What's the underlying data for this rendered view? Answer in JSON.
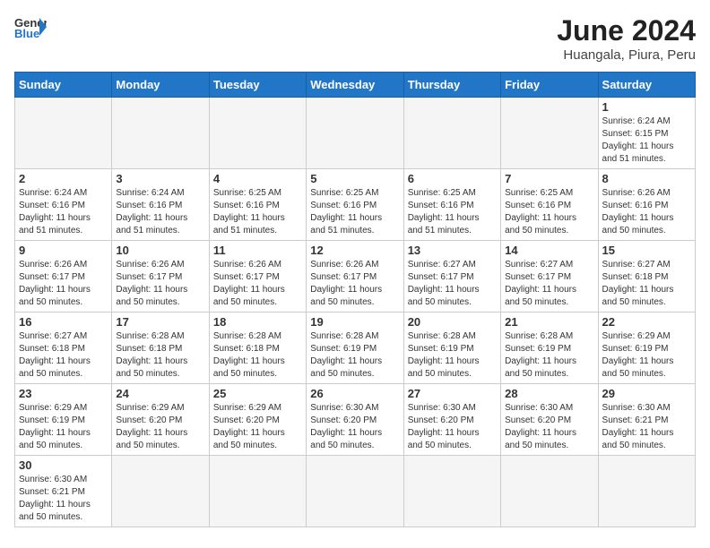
{
  "logo": {
    "text_general": "General",
    "text_blue": "Blue"
  },
  "title": "June 2024",
  "subtitle": "Huangala, Piura, Peru",
  "weekdays": [
    "Sunday",
    "Monday",
    "Tuesday",
    "Wednesday",
    "Thursday",
    "Friday",
    "Saturday"
  ],
  "weeks": [
    [
      {
        "day": "",
        "info": ""
      },
      {
        "day": "",
        "info": ""
      },
      {
        "day": "",
        "info": ""
      },
      {
        "day": "",
        "info": ""
      },
      {
        "day": "",
        "info": ""
      },
      {
        "day": "",
        "info": ""
      },
      {
        "day": "1",
        "info": "Sunrise: 6:24 AM\nSunset: 6:15 PM\nDaylight: 11 hours\nand 51 minutes."
      }
    ],
    [
      {
        "day": "2",
        "info": "Sunrise: 6:24 AM\nSunset: 6:16 PM\nDaylight: 11 hours\nand 51 minutes."
      },
      {
        "day": "3",
        "info": "Sunrise: 6:24 AM\nSunset: 6:16 PM\nDaylight: 11 hours\nand 51 minutes."
      },
      {
        "day": "4",
        "info": "Sunrise: 6:25 AM\nSunset: 6:16 PM\nDaylight: 11 hours\nand 51 minutes."
      },
      {
        "day": "5",
        "info": "Sunrise: 6:25 AM\nSunset: 6:16 PM\nDaylight: 11 hours\nand 51 minutes."
      },
      {
        "day": "6",
        "info": "Sunrise: 6:25 AM\nSunset: 6:16 PM\nDaylight: 11 hours\nand 51 minutes."
      },
      {
        "day": "7",
        "info": "Sunrise: 6:25 AM\nSunset: 6:16 PM\nDaylight: 11 hours\nand 50 minutes."
      },
      {
        "day": "8",
        "info": "Sunrise: 6:26 AM\nSunset: 6:16 PM\nDaylight: 11 hours\nand 50 minutes."
      }
    ],
    [
      {
        "day": "9",
        "info": "Sunrise: 6:26 AM\nSunset: 6:17 PM\nDaylight: 11 hours\nand 50 minutes."
      },
      {
        "day": "10",
        "info": "Sunrise: 6:26 AM\nSunset: 6:17 PM\nDaylight: 11 hours\nand 50 minutes."
      },
      {
        "day": "11",
        "info": "Sunrise: 6:26 AM\nSunset: 6:17 PM\nDaylight: 11 hours\nand 50 minutes."
      },
      {
        "day": "12",
        "info": "Sunrise: 6:26 AM\nSunset: 6:17 PM\nDaylight: 11 hours\nand 50 minutes."
      },
      {
        "day": "13",
        "info": "Sunrise: 6:27 AM\nSunset: 6:17 PM\nDaylight: 11 hours\nand 50 minutes."
      },
      {
        "day": "14",
        "info": "Sunrise: 6:27 AM\nSunset: 6:17 PM\nDaylight: 11 hours\nand 50 minutes."
      },
      {
        "day": "15",
        "info": "Sunrise: 6:27 AM\nSunset: 6:18 PM\nDaylight: 11 hours\nand 50 minutes."
      }
    ],
    [
      {
        "day": "16",
        "info": "Sunrise: 6:27 AM\nSunset: 6:18 PM\nDaylight: 11 hours\nand 50 minutes."
      },
      {
        "day": "17",
        "info": "Sunrise: 6:28 AM\nSunset: 6:18 PM\nDaylight: 11 hours\nand 50 minutes."
      },
      {
        "day": "18",
        "info": "Sunrise: 6:28 AM\nSunset: 6:18 PM\nDaylight: 11 hours\nand 50 minutes."
      },
      {
        "day": "19",
        "info": "Sunrise: 6:28 AM\nSunset: 6:19 PM\nDaylight: 11 hours\nand 50 minutes."
      },
      {
        "day": "20",
        "info": "Sunrise: 6:28 AM\nSunset: 6:19 PM\nDaylight: 11 hours\nand 50 minutes."
      },
      {
        "day": "21",
        "info": "Sunrise: 6:28 AM\nSunset: 6:19 PM\nDaylight: 11 hours\nand 50 minutes."
      },
      {
        "day": "22",
        "info": "Sunrise: 6:29 AM\nSunset: 6:19 PM\nDaylight: 11 hours\nand 50 minutes."
      }
    ],
    [
      {
        "day": "23",
        "info": "Sunrise: 6:29 AM\nSunset: 6:19 PM\nDaylight: 11 hours\nand 50 minutes."
      },
      {
        "day": "24",
        "info": "Sunrise: 6:29 AM\nSunset: 6:20 PM\nDaylight: 11 hours\nand 50 minutes."
      },
      {
        "day": "25",
        "info": "Sunrise: 6:29 AM\nSunset: 6:20 PM\nDaylight: 11 hours\nand 50 minutes."
      },
      {
        "day": "26",
        "info": "Sunrise: 6:30 AM\nSunset: 6:20 PM\nDaylight: 11 hours\nand 50 minutes."
      },
      {
        "day": "27",
        "info": "Sunrise: 6:30 AM\nSunset: 6:20 PM\nDaylight: 11 hours\nand 50 minutes."
      },
      {
        "day": "28",
        "info": "Sunrise: 6:30 AM\nSunset: 6:20 PM\nDaylight: 11 hours\nand 50 minutes."
      },
      {
        "day": "29",
        "info": "Sunrise: 6:30 AM\nSunset: 6:21 PM\nDaylight: 11 hours\nand 50 minutes."
      }
    ],
    [
      {
        "day": "30",
        "info": "Sunrise: 6:30 AM\nSunset: 6:21 PM\nDaylight: 11 hours\nand 50 minutes."
      },
      {
        "day": "",
        "info": ""
      },
      {
        "day": "",
        "info": ""
      },
      {
        "day": "",
        "info": ""
      },
      {
        "day": "",
        "info": ""
      },
      {
        "day": "",
        "info": ""
      },
      {
        "day": "",
        "info": ""
      }
    ]
  ]
}
